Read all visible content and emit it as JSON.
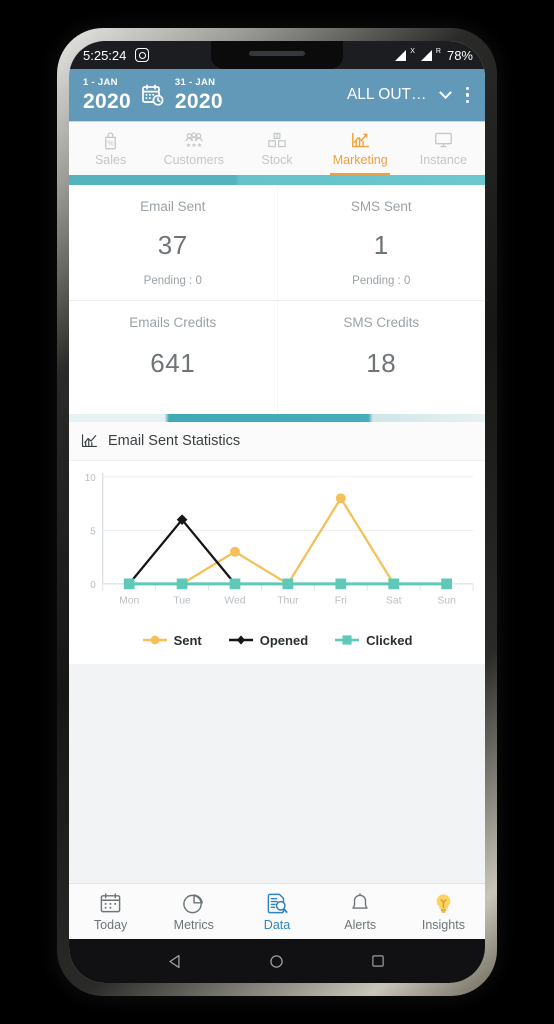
{
  "status_bar": {
    "time": "5:25:24",
    "notification_icon": "instagram-icon",
    "battery": "78%",
    "signal_labels": [
      "X",
      "R"
    ]
  },
  "header": {
    "date_from_day": "1 - JAN",
    "date_from_year": "2020",
    "date_to_day": "31 - JAN",
    "date_to_year": "2020",
    "calendar_icon": "calendar-clock-icon",
    "outlet_filter": "ALL OUT…",
    "dropdown_icon": "chevron-down-icon",
    "overflow_icon": "overflow-menu-icon",
    "bg_color": "#6399b8"
  },
  "tabs": [
    {
      "label": "Sales",
      "icon": "sales-tag-icon",
      "active": false
    },
    {
      "label": "Customers",
      "icon": "customers-group-icon",
      "active": false
    },
    {
      "label": "Stock",
      "icon": "stock-boxes-icon",
      "active": false
    },
    {
      "label": "Marketing",
      "icon": "marketing-chart-icon",
      "active": true
    },
    {
      "label": "Instance",
      "icon": "instance-monitor-icon",
      "active": false
    }
  ],
  "accent_color": "#f2a03d",
  "teal_color": "#54b3bd",
  "stats": [
    {
      "cells": [
        {
          "label": "Email Sent",
          "value": "37",
          "sub": "Pending : 0"
        },
        {
          "label": "SMS Sent",
          "value": "1",
          "sub": "Pending : 0"
        }
      ]
    },
    {
      "cells": [
        {
          "label": "Emails Credits",
          "value": "641",
          "sub": ""
        },
        {
          "label": "SMS Credits",
          "value": "18",
          "sub": ""
        }
      ]
    }
  ],
  "chart_card": {
    "icon": "bar-chart-icon",
    "title": "Email Sent Statistics"
  },
  "chart_data": {
    "type": "line",
    "title": "Email Sent Statistics",
    "xlabel": "",
    "ylabel": "",
    "categories": [
      "Mon",
      "Tue",
      "Wed",
      "Thur",
      "Fri",
      "Sat",
      "Sun"
    ],
    "yticks": [
      0,
      5,
      10
    ],
    "ylim": [
      0,
      10
    ],
    "grid": true,
    "legend_position": "bottom",
    "series": [
      {
        "name": "Sent",
        "color": "#f5c05a",
        "marker": "circle",
        "values": [
          0,
          0,
          3,
          0,
          8,
          0,
          0
        ]
      },
      {
        "name": "Opened",
        "color": "#161616",
        "marker": "diamond",
        "values": [
          0,
          6,
          0,
          0,
          0,
          0,
          0
        ]
      },
      {
        "name": "Clicked",
        "color": "#5ec9b7",
        "marker": "square",
        "values": [
          0,
          0,
          0,
          0,
          0,
          0,
          0
        ]
      }
    ]
  },
  "bottom_nav": [
    {
      "label": "Today",
      "icon": "calendar-icon",
      "active": false
    },
    {
      "label": "Metrics",
      "icon": "pie-chart-icon",
      "active": false
    },
    {
      "label": "Data",
      "icon": "data-search-icon",
      "active": true
    },
    {
      "label": "Alerts",
      "icon": "bell-icon",
      "active": false
    },
    {
      "label": "Insights",
      "icon": "lightbulb-icon",
      "active": false
    }
  ],
  "system_nav": [
    {
      "name": "back-button",
      "icon": "triangle-back-icon"
    },
    {
      "name": "home-button",
      "icon": "circle-home-icon"
    },
    {
      "name": "recents-button",
      "icon": "square-recents-icon"
    }
  ]
}
